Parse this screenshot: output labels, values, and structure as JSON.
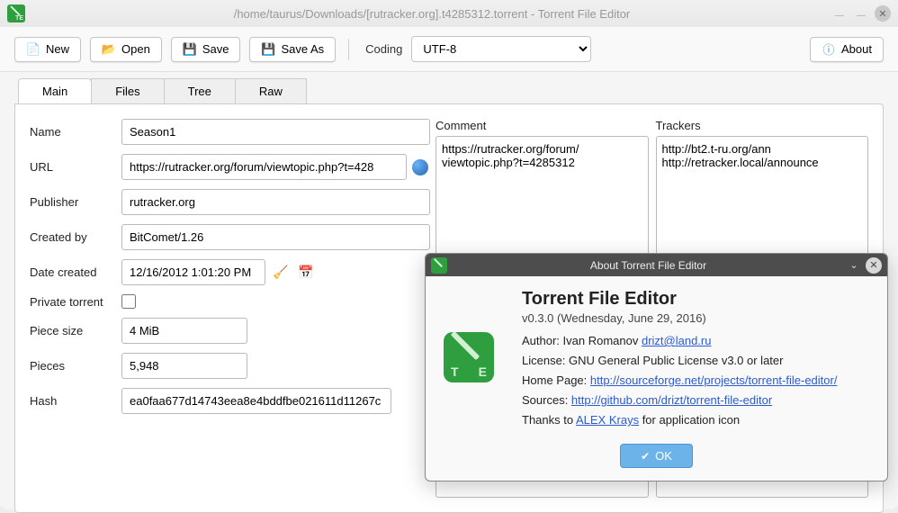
{
  "window": {
    "title": "/home/taurus/Downloads/[rutracker.org].t4285312.torrent - Torrent File Editor"
  },
  "toolbar": {
    "new_label": "New",
    "open_label": "Open",
    "save_label": "Save",
    "saveas_label": "Save As",
    "coding_label": "Coding",
    "coding_value": "UTF-8",
    "about_label": "About"
  },
  "tabs": {
    "main": "Main",
    "files": "Files",
    "tree": "Tree",
    "raw": "Raw",
    "active": "main"
  },
  "form": {
    "name_label": "Name",
    "name_value": "Season1",
    "url_label": "URL",
    "url_value": "https://rutracker.org/forum/viewtopic.php?t=428",
    "publisher_label": "Publisher",
    "publisher_value": "rutracker.org",
    "createdby_label": "Created by",
    "createdby_value": "BitComet/1.26",
    "datecreated_label": "Date created",
    "datecreated_value": "12/16/2012 1:01:20 PM",
    "private_label": "Private torrent",
    "private_value": false,
    "piecesize_label": "Piece size",
    "piecesize_value": "4 MiB",
    "pieces_label": "Pieces",
    "pieces_value": "5,948",
    "hash_label": "Hash",
    "hash_value": "ea0faa677d14743eea8e4bddfbe021611d11267c"
  },
  "comment": {
    "label": "Comment",
    "value": "https://rutracker.org/forum/\nviewtopic.php?t=4285312"
  },
  "trackers": {
    "label": "Trackers",
    "value": "http://bt2.t-ru.org/ann\nhttp://retracker.local/announce"
  },
  "about": {
    "dialog_title": "About Torrent File Editor",
    "heading": "Torrent File Editor",
    "version": "v0.3.0 (Wednesday, June 29, 2016)",
    "author_prefix": "Author: Ivan Romanov ",
    "author_link": "drizt@land.ru",
    "license": "License: GNU General Public License v3.0 or later",
    "homepage_prefix": "Home Page: ",
    "homepage_link": "http://sourceforge.net/projects/torrent-file-editor/",
    "sources_prefix": "Sources: ",
    "sources_link": "http://github.com/drizt/torrent-file-editor",
    "thanks_prefix": "Thanks to ",
    "thanks_link": "ALEX Krays",
    "thanks_suffix": " for application icon",
    "ok_label": "OK"
  }
}
